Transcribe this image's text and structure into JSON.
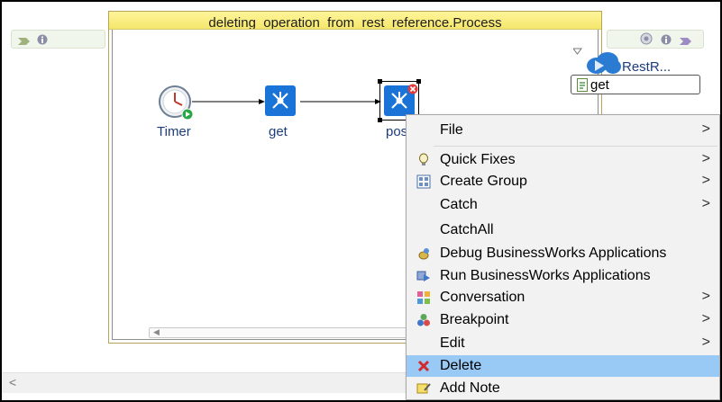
{
  "process": {
    "title": "deleting_operation_from_rest_reference.Process"
  },
  "activities": {
    "timer": {
      "label": "Timer",
      "icon": "timer-icon"
    },
    "get": {
      "label": "get",
      "icon": "rest-invoke-icon"
    },
    "post": {
      "label": "post",
      "icon": "rest-invoke-icon",
      "selected": true
    }
  },
  "reference": {
    "label": "RestR...",
    "icon": "cloud-rest-icon",
    "operation": "get"
  },
  "context_menu": {
    "items": [
      {
        "label": "File",
        "icon": "",
        "submenu": true
      },
      {
        "label": "Quick Fixes",
        "icon": "lightbulb-icon",
        "submenu": true
      },
      {
        "label": "Create Group",
        "icon": "group-icon",
        "submenu": true
      },
      {
        "label": "Catch",
        "icon": "",
        "submenu": true
      },
      {
        "label": "CatchAll",
        "icon": "",
        "submenu": false
      },
      {
        "label": "Debug BusinessWorks Applications",
        "icon": "debug-icon",
        "submenu": false
      },
      {
        "label": "Run BusinessWorks Applications",
        "icon": "run-icon",
        "submenu": false
      },
      {
        "label": "Conversation",
        "icon": "conversation-icon",
        "submenu": true
      },
      {
        "label": "Breakpoint",
        "icon": "breakpoint-icon",
        "submenu": true
      },
      {
        "label": "Edit",
        "icon": "",
        "submenu": true
      },
      {
        "label": "Delete",
        "icon": "delete-icon",
        "submenu": false,
        "highlighted": true
      },
      {
        "label": "Add Note",
        "icon": "note-icon",
        "submenu": false
      }
    ],
    "submenu_arrow": ">"
  },
  "colors": {
    "header_yellow": "#fff59a",
    "activity_blue": "#1a73d6",
    "highlight": "#99c9f5",
    "label_blue": "#1c3d7e"
  }
}
